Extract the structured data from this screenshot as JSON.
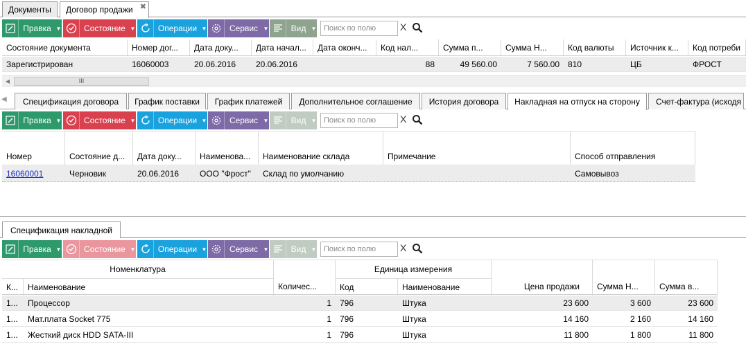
{
  "doc_tabs": [
    "Документы",
    "Договор продажи"
  ],
  "toolbar": {
    "edit": "Правка",
    "state": "Состояние",
    "ops": "Операции",
    "serv": "Сервис",
    "view": "Вид",
    "search_placeholder": "Поиск по полю",
    "clear": "X"
  },
  "contract_grid": {
    "columns": [
      "Состояние документа",
      "Номер дог...",
      "Дата доку...",
      "Дата начал...",
      "Дата оконч...",
      "Код нал...",
      "Сумма п...",
      "Сумма Н...",
      "Код валюты",
      "Источник к...",
      "Код потреби"
    ],
    "row": [
      "Зарегистрирован",
      "16060003",
      "20.06.2016",
      "20.06.2016",
      "",
      "88",
      "49 560.00",
      "7 560.00",
      "810",
      "ЦБ",
      "ФРОСТ"
    ]
  },
  "scroll_glyph": "III",
  "sub_tabs": [
    "Спецификация договора",
    "График поставки",
    "График платежей",
    "Дополнительное соглашение",
    "История договора",
    "Накладная на отпуск на сторону",
    "Счет-фактура (исходя"
  ],
  "invoice_grid": {
    "columns": [
      "Номер",
      "Состояние д...",
      "Дата доку...",
      "Наименова...",
      "Наименование склада",
      "Примечание",
      "Способ отправления"
    ],
    "row": [
      "16060001",
      "Черновик",
      "20.06.2016",
      "ООО \"Фрост\"",
      "Склад по умолчанию",
      "",
      "Самовывоз"
    ]
  },
  "spec_tab": "Спецификация накладной",
  "spec_grid": {
    "group_nom": "Номенклатура",
    "group_unit": "Единица измерения",
    "columns": [
      "К...",
      "Наименование",
      "Количес...",
      "Код",
      "Наименование",
      "Цена продажи",
      "Сумма Н...",
      "Сумма в..."
    ],
    "rows": [
      [
        "1...",
        "Процессор",
        "1",
        "796",
        "Штука",
        "23 600",
        "3 600",
        "23 600"
      ],
      [
        "1...",
        "Мат.плата Socket 775",
        "1",
        "796",
        "Штука",
        "14 160",
        "2 160",
        "14 160"
      ],
      [
        "1...",
        "Жесткий диск HDD SATA-III",
        "1",
        "796",
        "Штука",
        "11 800",
        "1 800",
        "11 800"
      ]
    ]
  },
  "colors": {
    "edit": "#2e9a6c",
    "state": "#d9414f",
    "ops": "#1aa2de",
    "serv": "#7d6aa6",
    "view": "#8ea48f"
  }
}
